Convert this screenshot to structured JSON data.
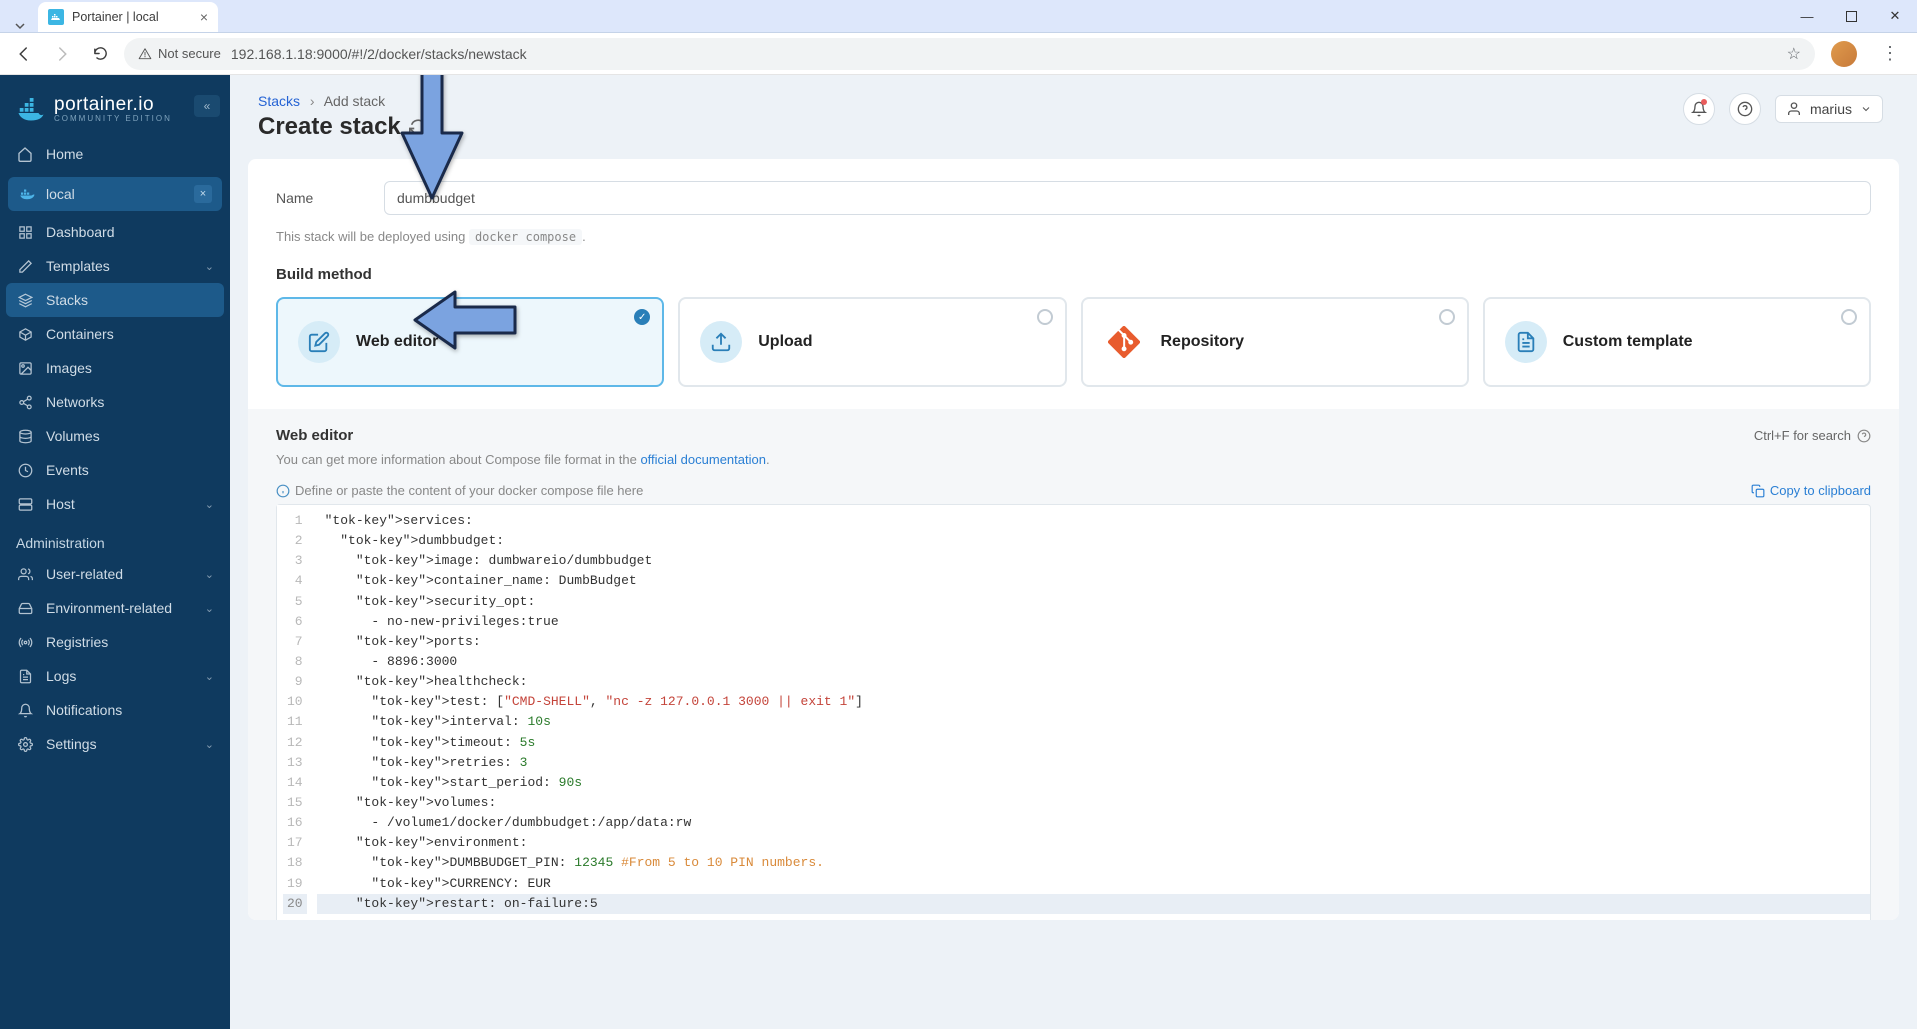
{
  "browser": {
    "tab_title": "Portainer | local",
    "not_secure": "Not secure",
    "url": "192.168.1.18:9000/#!/2/docker/stacks/newstack"
  },
  "sidebar": {
    "brand": "portainer.io",
    "brand_sub": "COMMUNITY EDITION",
    "home": "Home",
    "env_name": "local",
    "items": {
      "dashboard": "Dashboard",
      "templates": "Templates",
      "stacks": "Stacks",
      "containers": "Containers",
      "images": "Images",
      "networks": "Networks",
      "volumes": "Volumes",
      "events": "Events",
      "host": "Host"
    },
    "admin_header": "Administration",
    "admin": {
      "user": "User-related",
      "env": "Environment-related",
      "registries": "Registries",
      "logs": "Logs",
      "notifications": "Notifications",
      "settings": "Settings"
    }
  },
  "header": {
    "crumb_root": "Stacks",
    "crumb_current": "Add stack",
    "title": "Create stack",
    "username": "marius"
  },
  "form": {
    "name_label": "Name",
    "name_value": "dumbbudget",
    "deploy_hint_prefix": "This stack will be deployed using ",
    "deploy_hint_code": "docker compose",
    "deploy_hint_suffix": "."
  },
  "build": {
    "section": "Build method",
    "web": "Web editor",
    "upload": "Upload",
    "repo": "Repository",
    "custom": "Custom template"
  },
  "editor": {
    "title": "Web editor",
    "search_hint": "Ctrl+F for search",
    "sub_prefix": "You can get more information about Compose file format in the ",
    "sub_link": "official documentation",
    "placeholder": "Define or paste the content of your docker compose file here",
    "copy": "Copy to clipboard"
  },
  "code": {
    "lines": [
      "services:",
      "  dumbbudget:",
      "    image: dumbwareio/dumbbudget",
      "    container_name: DumbBudget",
      "    security_opt:",
      "      - no-new-privileges:true",
      "    ports:",
      "      - 8896:3000",
      "    healthcheck:",
      "      test: [\"CMD-SHELL\", \"nc -z 127.0.0.1 3000 || exit 1\"]",
      "      interval: 10s",
      "      timeout: 5s",
      "      retries: 3",
      "      start_period: 90s",
      "    volumes:",
      "      - /volume1/docker/dumbbudget:/app/data:rw",
      "    environment:",
      "      DUMBBUDGET_PIN: 12345 #From 5 to 10 PIN numbers.",
      "      CURRENCY: EUR",
      "    restart: on-failure:5"
    ]
  }
}
